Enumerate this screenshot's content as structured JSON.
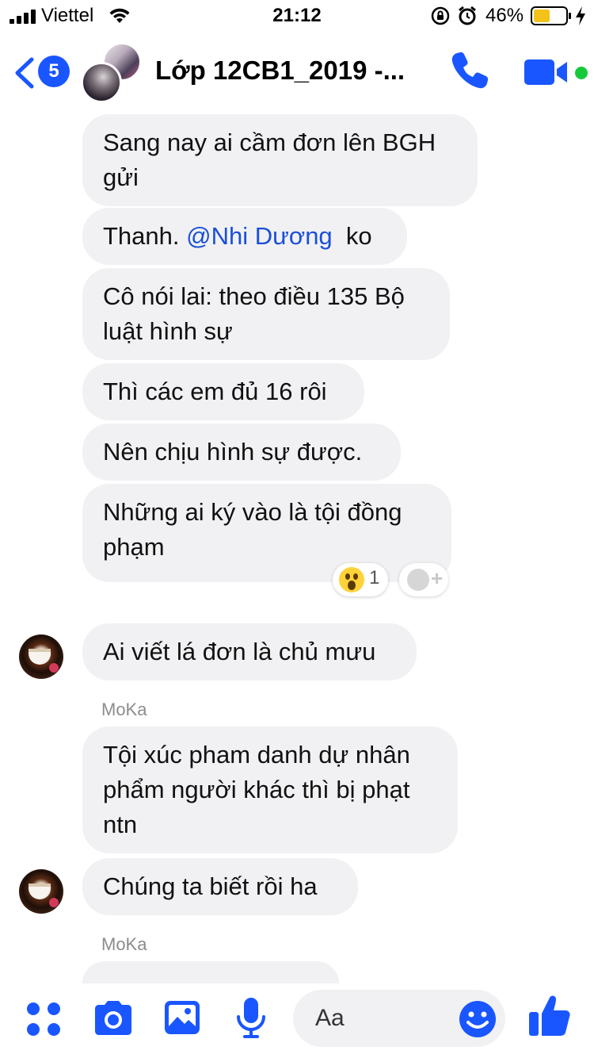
{
  "status_bar": {
    "carrier": "Viettel",
    "time": "21:12",
    "battery_percent": "46%"
  },
  "header": {
    "back_count": "5",
    "title": "Lớp 12CB1_2019 -..."
  },
  "messages": [
    {
      "text": "Sang nay ai cầm đơn lên BGH gửi"
    },
    {
      "text_before": "Thanh. ",
      "mention": "@Nhi Dương",
      "text_after": "  ko"
    },
    {
      "text": "Cô nói lai: theo điều 135 Bộ luật hình sự"
    },
    {
      "text": "Thì các em đủ 16 rôi"
    },
    {
      "text": "Nên chịu hình sự được."
    },
    {
      "text": "Những ai ký vào là tội đồng phạm"
    },
    {
      "text": "Ai viết lá đơn là chủ mưu"
    },
    {
      "sender": "MoKa",
      "text": "Tội xúc pham danh dự nhân phẩm người khác thì bị phạt ntn"
    },
    {
      "text": "Chúng ta biết rồi ha"
    },
    {
      "sender": "MoKa"
    }
  ],
  "reaction": {
    "emoji": "wow-emoji",
    "count": "1"
  },
  "composer": {
    "placeholder": "Aa"
  },
  "icons": {
    "back": "chevron-left-icon",
    "call": "phone-icon",
    "video": "video-camera-icon",
    "apps": "grid-dots-icon",
    "camera": "camera-icon",
    "gallery": "image-icon",
    "mic": "microphone-icon",
    "emoji": "smiley-icon",
    "like": "thumbs-up-icon"
  },
  "colors": {
    "accent": "#1a56ff",
    "bubble": "#f1f1f3",
    "mention": "#1a4fd8",
    "online": "#17c93a"
  }
}
